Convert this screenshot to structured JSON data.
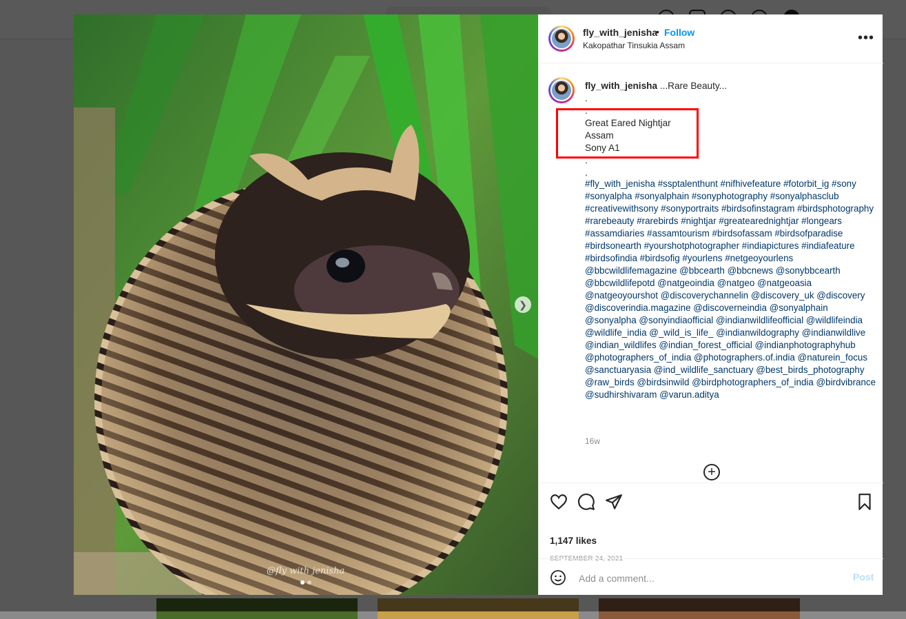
{
  "post": {
    "username": "fly_with_jenisha",
    "separator": "•",
    "follow_label": "Follow",
    "location": "Kakopathar Tinsukia Assam",
    "watermark": "@fly with jenisha"
  },
  "caption": {
    "username": "fly_with_jenisha",
    "text_first": " ...Rare Beauty...",
    "lines": [
      ".",
      ".",
      "Great Eared Nightjar",
      "Assam",
      "Sony A1",
      ".",
      "."
    ],
    "hashtags": "#fly_with_jenisha #ssptalenthunt #nifhivefeature #fotorbit_ig #sony #sonyalpha #sonyalphain #sonyphotography #sonyalphasclub #creativewithsony #sonyportraits #birdsofinstagram #birdsphotography #rarebeauty #rarebirds #nightjar #greatearednightjar #longears #assamdiaries #assamtourism #birdsofassam #birdsofparadise #birdsonearth #yourshotphotographer #indiapictures #indiafeature #birdsofindia #birdsofig #yourlens #netgeoyourlens @bbcwildlifemagazine @bbcearth @bbcnews @sonybbcearth @bbcwildlifepotd @natgeoindia @natgeo @natgeoasia @natgeoyourshot @discoverychannelin @discovery_uk @discovery @discoverindia.magazine @discoverneindia @sonyalphain @sonyalpha @sonyindiaofficial @indianwildlifeofficial @wildlifeindia @wildlife_india @_wild_is_life_ @indianwildography @indianwildlive @indian_wildlifes @indian_forest_official @indianphotographyhub @photographers_of_india @photographers.of.india @naturein_focus @sanctuaryasia @ind_wildlife_sanctuary @best_birds_photography @raw_birds @birdsinwild @birdphotographers_of_india @birdvibrance @sudhirshivaram @varun.aditya",
    "time_ago": "16w"
  },
  "stats": {
    "likes": "1,147 likes",
    "date": "SEPTEMBER 24, 2021"
  },
  "comment": {
    "placeholder": "Add a comment...",
    "post_label": "Post"
  },
  "icons": {
    "more": "more-options-icon",
    "next": "chevron-right-icon",
    "like": "heart-icon",
    "comment": "comment-icon",
    "share": "paper-plane-icon",
    "save": "bookmark-icon",
    "emoji": "emoji-icon",
    "load_more": "plus-circle-icon"
  },
  "colors": {
    "link": "#0095f6",
    "hashtag": "#00376b",
    "highlight": "#ff0000",
    "post_disabled": "#b3dffc"
  }
}
